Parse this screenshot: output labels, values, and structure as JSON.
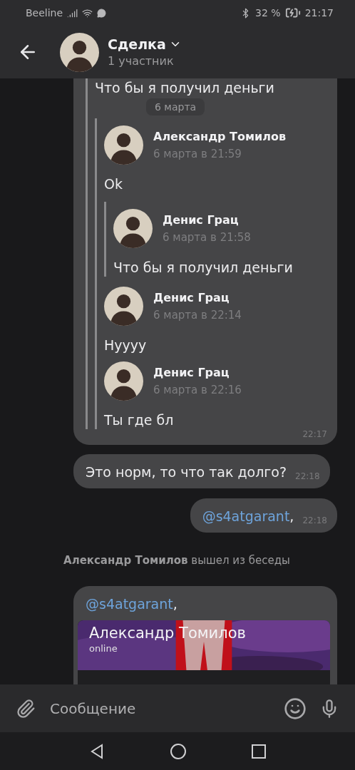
{
  "status_bar": {
    "carrier": "Beeline",
    "battery": "32 %",
    "time": "21:17"
  },
  "header": {
    "title": "Сделка",
    "subtitle": "1 участник"
  },
  "date_pill": "6 марта",
  "forward_bubble": {
    "text": "Что бы я получил деньги",
    "time": "22:17",
    "forwards": [
      {
        "author": "Александр Томилов",
        "date": "6 марта в 21:59",
        "text": "Ok",
        "children": [
          {
            "author": "Денис Грац",
            "date": "6 марта в 21:58",
            "text": "Что бы я получил деньги"
          }
        ]
      },
      {
        "author": "Денис Грац",
        "date": "6 марта в 22:14",
        "text": "Нуууу"
      },
      {
        "author": "Денис Грац",
        "date": "6 марта в 22:16",
        "text": "Ты где бл"
      }
    ]
  },
  "messages": [
    {
      "kind": "text",
      "text": "Это норм, то что так долго?",
      "time": "22:18",
      "outgoing": false
    },
    {
      "kind": "mention",
      "text": "@s4atgarant",
      "suffix": ",",
      "time": "22:18",
      "outgoing": true
    }
  ],
  "service": {
    "name": "Александр Томилов",
    "text": "вышел из беседы"
  },
  "last_bubble": {
    "mention": "@s4atgarant",
    "suffix": ",",
    "card": {
      "kind": "picture",
      "name": "Александр Томилов",
      "status": "online"
    }
  },
  "composer": {
    "placeholder": "Сообщение"
  }
}
